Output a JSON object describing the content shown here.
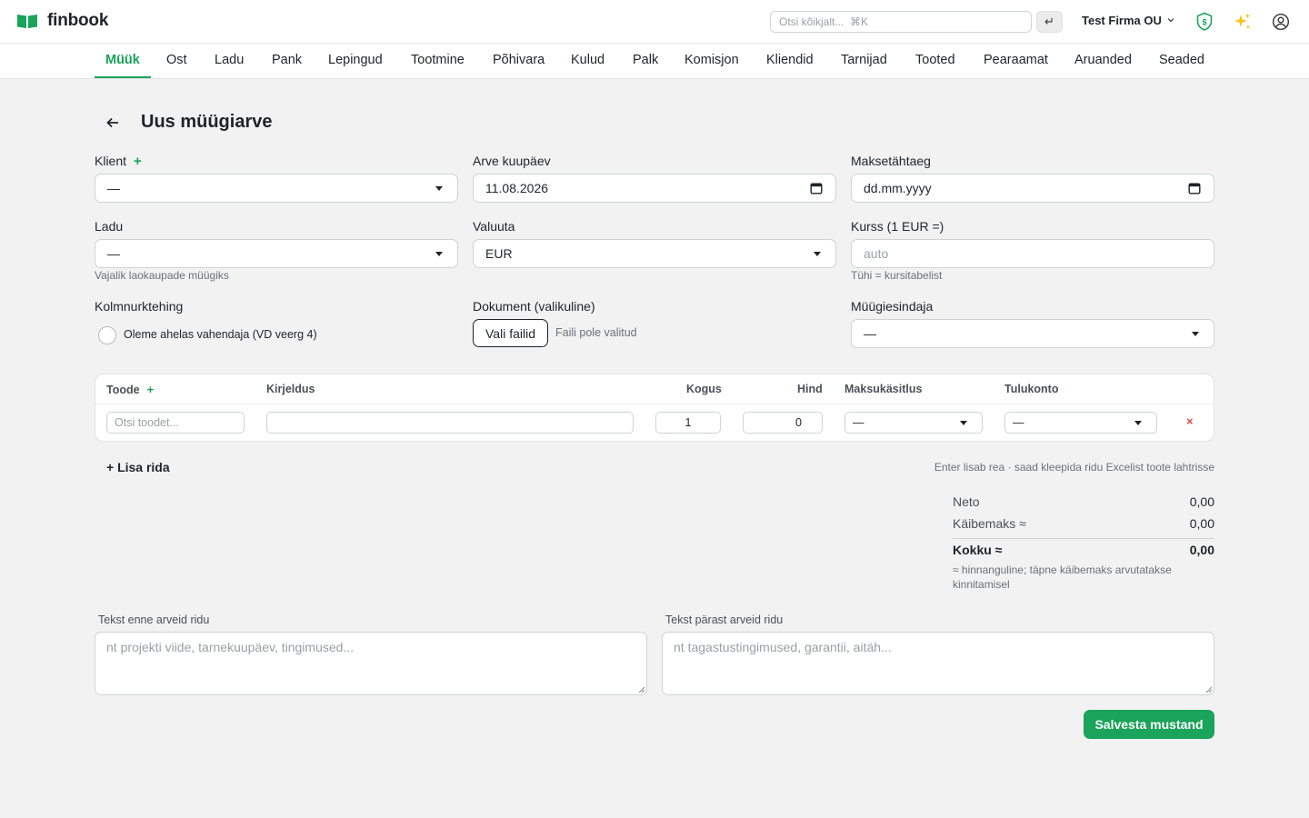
{
  "app": {
    "logo_text": "finbook",
    "logo_icon": "open-book-icon",
    "search_placeholder": "Otsi kõikjalt...  ⌘K",
    "enter_symbol": "↵",
    "company_name": "Test Firma OU",
    "company_chevron": "chevron-down-icon",
    "shield_label": "$",
    "accent_color": "#1aa35a"
  },
  "nav": {
    "active": "Müük",
    "items": [
      "Müük",
      "Ost",
      "Ladu",
      "Pank",
      "Lepingud",
      "Tootmine",
      "Põhivara",
      "Kulud",
      "Palk",
      "Komisjon",
      "Kliendid",
      "Tarnijad",
      "Tooted",
      "Pearaamat",
      "Aruanded",
      "Seaded"
    ]
  },
  "page": {
    "back_symbol": "←",
    "title": "Uus müügiarve"
  },
  "form": {
    "klient": {
      "label": "Klient",
      "add_symbol": "+",
      "value": "—"
    },
    "arve_kuupaev": {
      "label": "Arve kuupäev",
      "value": "11.08.2026"
    },
    "maksetahtaeg": {
      "label": "Maksetähtaeg",
      "value": "dd.mm.yyyy"
    },
    "ladu": {
      "label": "Ladu",
      "value": "—",
      "hint": "Vajalik laokaupade müügiks"
    },
    "valuuta": {
      "label": "Valuuta",
      "value": "EUR"
    },
    "kurss": {
      "label": "Kurss (1 EUR =)",
      "placeholder": "auto",
      "hint": "Tühi = kursitabelist"
    },
    "kolmnurktehing": {
      "label": "Kolmnurktehing",
      "checkbox_label": "Oleme ahelas vahendaja (VD veerg 4)"
    },
    "dokument": {
      "label": "Dokument (valikuline)",
      "button": "Vali failid",
      "status": "Faili pole valitud"
    },
    "myygiesindaja": {
      "label": "Müügiesindaja",
      "value": "—"
    }
  },
  "table": {
    "headers": {
      "toode": "Toode",
      "toode_add": "+",
      "kirjeldus": "Kirjeldus",
      "kogus": "Kogus",
      "hind": "Hind",
      "maksukasitlus": "Maksukäsitlus",
      "tulukonto": "Tulukonto"
    },
    "rows": [
      {
        "toode_placeholder": "Otsi toodet...",
        "kirjeldus": "",
        "kogus": "1",
        "hind": "0",
        "maksukasitlus": "—",
        "tulukonto": "—",
        "delete_symbol": "×"
      }
    ],
    "add_row": "+ Lisa rida",
    "hint": "Enter lisab rea · saad kleepida ridu Excelist toote lahtrisse"
  },
  "totals": {
    "neto_label": "Neto",
    "neto_value": "0,00",
    "kaibemaks_label": "Käibemaks ≈",
    "kaibemaks_value": "0,00",
    "kokku_label": "Kokku ≈",
    "kokku_value": "0,00",
    "note": "≈ hinnanguline; täpne käibemaks arvutatakse kinnitamisel"
  },
  "texts": {
    "before_label": "Tekst enne arveid ridu",
    "before_placeholder": "nt projekti viide, tarnekuupäev, tingimused...",
    "after_label": "Tekst pärast arveid ridu",
    "after_placeholder": "nt tagastustingimused, garantii, aitäh..."
  },
  "actions": {
    "save": "Salvesta mustand"
  }
}
